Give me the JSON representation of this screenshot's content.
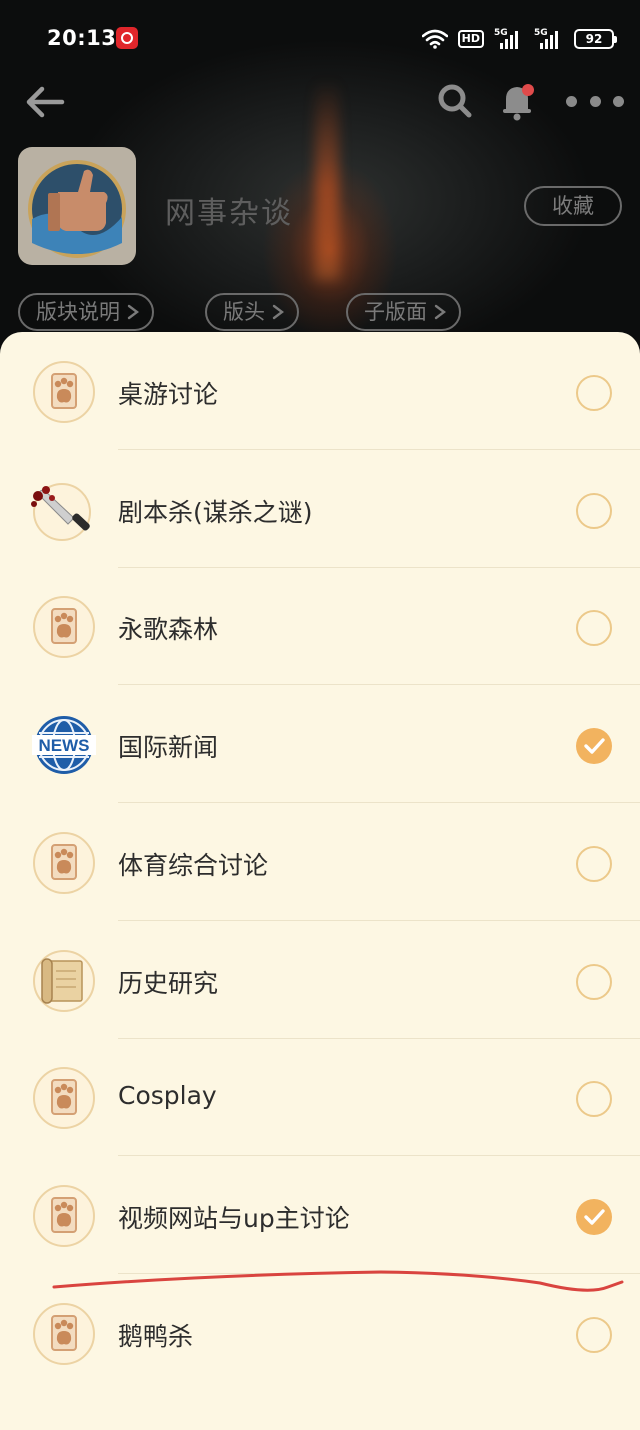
{
  "status_bar": {
    "time": "20:13",
    "hd": "HD",
    "net1": "5G",
    "net2": "5G",
    "battery": "92"
  },
  "nav": {
    "back_icon": "arrow-left-icon",
    "search_icon": "search-icon",
    "bell_icon": "bell-icon",
    "more_icon": "more-horizontal-icon"
  },
  "forum": {
    "title": "网事杂谈",
    "favorite_label": "收藏",
    "pills": [
      "版块说明",
      "版头",
      "子版面"
    ]
  },
  "colors": {
    "sheet_bg": "#fdf7e3",
    "check_on": "#f2b35f",
    "check_off_border": "#ecc98a",
    "annotation_red": "#d9443f"
  },
  "list": [
    {
      "label": "桌游讨论",
      "icon": "paw-default-icon",
      "checked": false
    },
    {
      "label": "剧本杀(谋杀之谜)",
      "icon": "bloody-knife-icon",
      "checked": false
    },
    {
      "label": "永歌森林",
      "icon": "paw-default-icon",
      "checked": false
    },
    {
      "label": "国际新闻",
      "icon": "news-globe-icon",
      "checked": true
    },
    {
      "label": "体育综合讨论",
      "icon": "paw-default-icon",
      "checked": false
    },
    {
      "label": "历史研究",
      "icon": "scroll-icon",
      "checked": false
    },
    {
      "label": "Cosplay",
      "icon": "paw-default-icon",
      "checked": false
    },
    {
      "label": "视频网站与up主讨论",
      "icon": "paw-default-icon",
      "checked": true
    },
    {
      "label": "鹅鸭杀",
      "icon": "paw-default-icon",
      "checked": false
    }
  ]
}
